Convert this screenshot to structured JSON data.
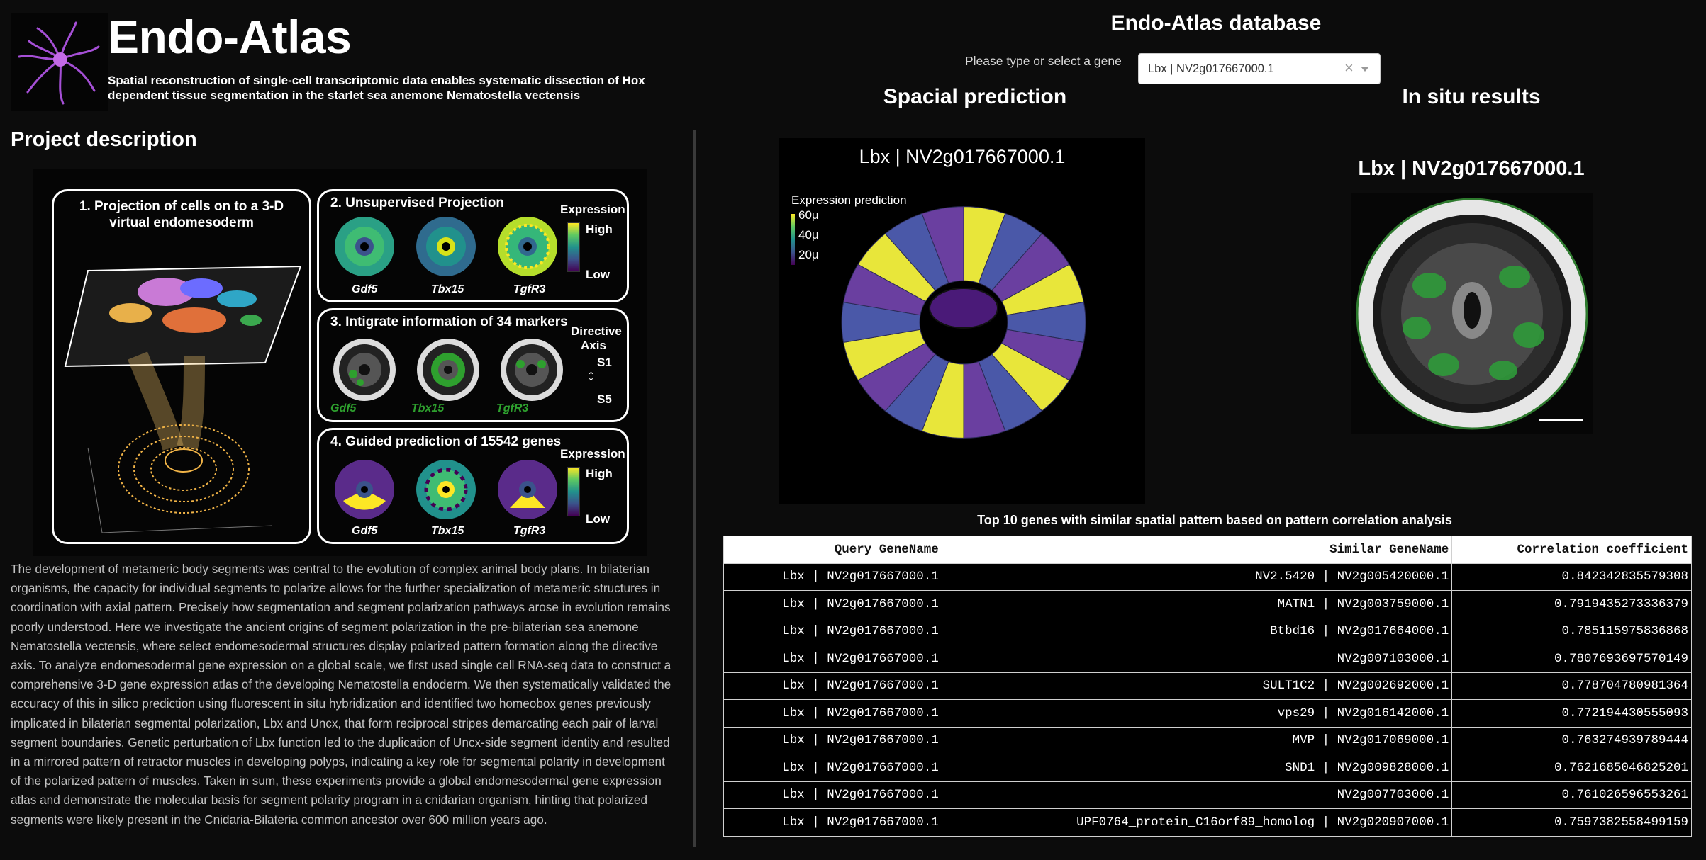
{
  "app": {
    "title": "Endo-Atlas",
    "subtitle": "Spatial reconstruction of single-cell transcriptomic data enables systematic dissection of Hox dependent tissue segmentation in the starlet sea anemone Nematostella vectensis"
  },
  "project": {
    "heading": "Project description",
    "description": "The development of metameric body segments was central to the evolution of complex animal body plans. In bilaterian organisms, the capacity for individual segments to polarize allows for the further specialization of metameric structures in coordination with axial pattern. Precisely how segmentation and segment polarization pathways arose in evolution remains poorly understood. Here we investigate the ancient origins of segment polarization in the pre-bilaterian sea anemone Nematostella vectensis, where select endomesodermal structures display polarized pattern formation along the directive axis. To analyze endomesodermal gene expression on a global scale, we first used single cell RNA-seq data to construct a comprehensive 3-D gene expression atlas of the developing Nematostella endoderm. We then systematically validated the accuracy of this in silico prediction using fluorescent in situ hybridization and identified two homeobox genes previously implicated in bilaterian segmental polarization, Lbx and Uncx, that form reciprocal stripes demarcating each pair of larval segment boundaries. Genetic perturbation of Lbx function led to the duplication of Uncx-side segment identity and resulted in a mirrored pattern of retractor muscles in developing polyps, indicating a key role for segmental polarity in development of the polarized pattern of muscles. Taken in sum, these experiments provide a global endomesodermal gene expression atlas and demonstrate the molecular basis for segment polarity program in a cnidarian organism, hinting that polarized segments were likely present in the Cnidaria-Bilateria common ancestor over 600 million years ago."
  },
  "figure": {
    "panel1_title": "1. Projection of cells on to a 3-D virtual endomesoderm",
    "panel2_title": "2. Unsupervised Projection",
    "panel3_title": "3. Intigrate information of 34 markers",
    "panel4_title": "4. Guided prediction of 15542 genes",
    "expression_label": "Expression",
    "high_label": "High",
    "low_label": "Low",
    "directive_axis_label": "Directive Axis",
    "s1_label": "S1",
    "s5_label": "S5",
    "genes": [
      "Gdf5",
      "Tbx15",
      "TgfR3"
    ]
  },
  "database": {
    "title": "Endo-Atlas database",
    "gene_prompt": "Please type or select a gene",
    "selected_gene": "Lbx | NV2g017667000.1",
    "clear_glyph": "×"
  },
  "spatial": {
    "heading": "Spacial prediction",
    "gene_title": "Lbx | NV2g017667000.1",
    "legend_title": "Expression prediction",
    "ticks": [
      "60μ",
      "40μ",
      "20μ"
    ],
    "stripe_colors": [
      "#e8e63a",
      "#4a58a8",
      "#6a3fa0"
    ]
  },
  "insitu": {
    "heading": "In situ results",
    "gene_title": "Lbx | NV2g017667000.1"
  },
  "similar": {
    "caption": "Top 10 genes with similar spatial pattern based on pattern correlation analysis",
    "columns": [
      "Query GeneName",
      "Similar GeneName",
      "Correlation coefficient"
    ],
    "rows": [
      [
        "Lbx | NV2g017667000.1",
        "NV2.5420 | NV2g005420000.1",
        "0.842342835579308"
      ],
      [
        "Lbx | NV2g017667000.1",
        "MATN1 | NV2g003759000.1",
        "0.7919435273336379"
      ],
      [
        "Lbx | NV2g017667000.1",
        "Btbd16 | NV2g017664000.1",
        "0.785115975836868"
      ],
      [
        "Lbx | NV2g017667000.1",
        "NV2g007103000.1",
        "0.7807693697570149"
      ],
      [
        "Lbx | NV2g017667000.1",
        "SULT1C2 | NV2g002692000.1",
        "0.778704780981364"
      ],
      [
        "Lbx | NV2g017667000.1",
        "vps29 | NV2g016142000.1",
        "0.772194430555093"
      ],
      [
        "Lbx | NV2g017667000.1",
        "MVP | NV2g017069000.1",
        "0.763274939789444"
      ],
      [
        "Lbx | NV2g017667000.1",
        "SND1 | NV2g009828000.1",
        "0.7621685046825201"
      ],
      [
        "Lbx | NV2g017667000.1",
        "NV2g007703000.1",
        "0.761026596553261"
      ],
      [
        "Lbx | NV2g017667000.1",
        "UPF0764_protein_C16orf89_homolog | NV2g020907000.1",
        "0.7597382558499159"
      ]
    ]
  }
}
